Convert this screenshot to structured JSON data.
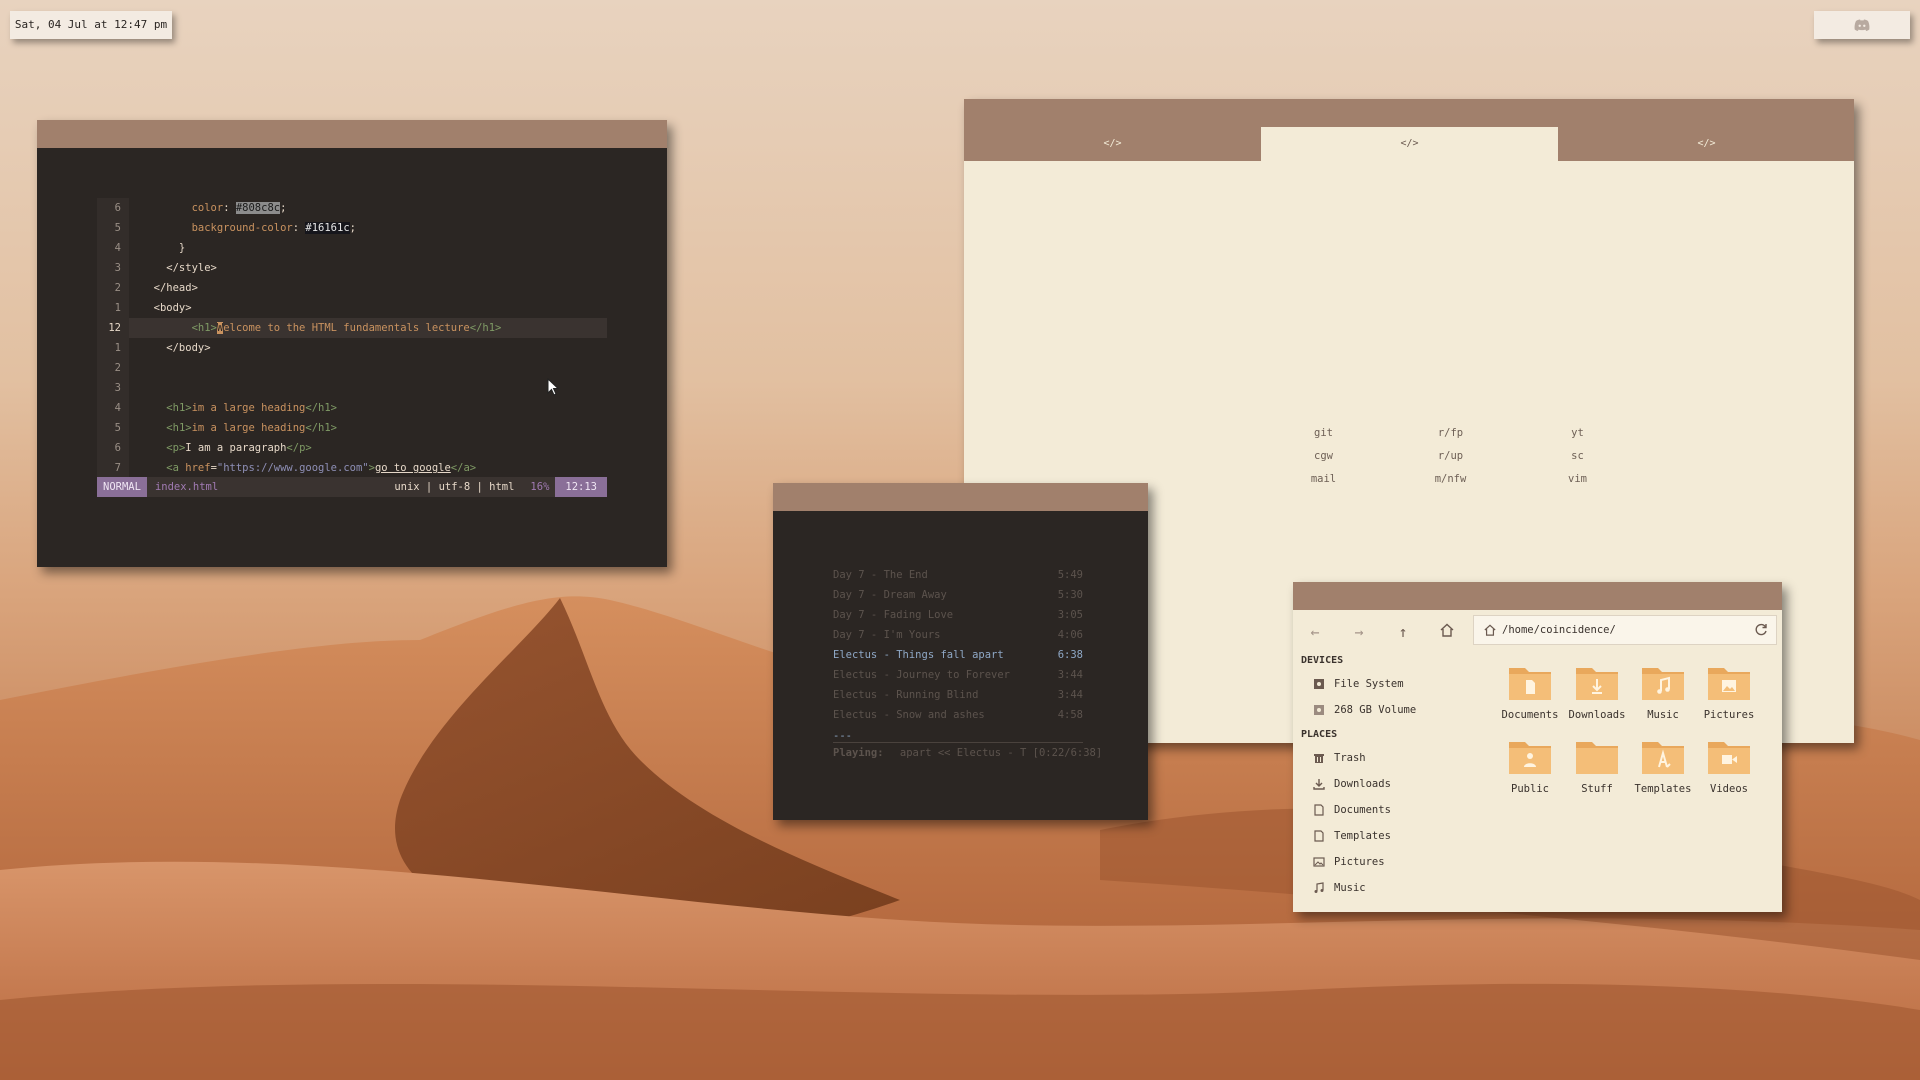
{
  "topbar": {
    "datetime": "Sat, 04 Jul at 12:47 pm",
    "tray_icon": "discord-icon"
  },
  "vim": {
    "lines": [
      {
        "num": "6",
        "code": "color: #808c8c;"
      },
      {
        "num": "5",
        "code": "background-color: #16161c;"
      },
      {
        "num": "4",
        "code": "}"
      },
      {
        "num": "3",
        "code": "</style>"
      },
      {
        "num": "2",
        "code": "</head>"
      },
      {
        "num": "1",
        "code": "<body>"
      },
      {
        "num": "12",
        "code": "<h1>Welcome to the HTML fundamentals lecture</h1>"
      },
      {
        "num": "1",
        "code": "</body>"
      },
      {
        "num": "2",
        "code": ""
      },
      {
        "num": "3",
        "code": ""
      },
      {
        "num": "4",
        "code": "<h1>im a large heading</h1>"
      },
      {
        "num": "5",
        "code": "<h1>im a large heading</h1>"
      },
      {
        "num": "6",
        "code": "<p>I am a paragraph</p>"
      },
      {
        "num": "7",
        "code": "<a href=\"https://www.google.com\">go to google</a>"
      }
    ],
    "status": {
      "mode": "NORMAL",
      "file": "index.html",
      "encoding": "unix | utf-8 | html",
      "percent": "16%",
      "position": "12:13"
    }
  },
  "startpage": {
    "tabs": [
      "</>",
      "</>",
      "</>"
    ],
    "active_tab": 1,
    "links": [
      "git",
      "r/fp",
      "yt",
      "cgw",
      "r/up",
      "sc",
      "mail",
      "m/nfw",
      "vim"
    ]
  },
  "music": {
    "tracks": [
      {
        "title": "Day 7 - The End",
        "time": "5:49"
      },
      {
        "title": "Day 7 - Dream Away",
        "time": "5:30"
      },
      {
        "title": "Day 7 - Fading Love",
        "time": "3:05"
      },
      {
        "title": "Day 7 - I'm Yours",
        "time": "4:06"
      },
      {
        "title": "Electus - Things fall apart",
        "time": "6:38"
      },
      {
        "title": "Electus - Journey to Forever",
        "time": "3:44"
      },
      {
        "title": "Electus - Running Blind",
        "time": "3:44"
      },
      {
        "title": "Electus - Snow and ashes",
        "time": "4:58"
      }
    ],
    "playing_index": 4,
    "separator": "---",
    "now_playing_label": "Playing:",
    "now_playing_value": "apart << Electus - T [0:22/6:38]"
  },
  "files": {
    "path": "/home/coincidence/",
    "devices_header": "DEVICES",
    "devices": [
      {
        "label": "File System",
        "icon": "hard-drive-icon"
      },
      {
        "label": "268 GB Volume",
        "icon": "hard-drive-icon"
      }
    ],
    "places_header": "PLACES",
    "places": [
      {
        "label": "Trash",
        "icon": "trash-icon"
      },
      {
        "label": "Downloads",
        "icon": "download-icon"
      },
      {
        "label": "Documents",
        "icon": "document-icon"
      },
      {
        "label": "Templates",
        "icon": "template-icon"
      },
      {
        "label": "Pictures",
        "icon": "picture-icon"
      },
      {
        "label": "Music",
        "icon": "music-note-icon"
      }
    ],
    "folders": [
      {
        "label": "Documents",
        "icon": "folder-documents-icon"
      },
      {
        "label": "Downloads",
        "icon": "folder-downloads-icon"
      },
      {
        "label": "Music",
        "icon": "folder-music-icon"
      },
      {
        "label": "Pictures",
        "icon": "folder-pictures-icon"
      },
      {
        "label": "Public",
        "icon": "folder-public-icon"
      },
      {
        "label": "Stuff",
        "icon": "folder-icon"
      },
      {
        "label": "Templates",
        "icon": "folder-templates-icon"
      },
      {
        "label": "Videos",
        "icon": "folder-videos-icon"
      }
    ]
  },
  "colors": {
    "titlebar": "#a1806c",
    "panel_dark": "#2b2623",
    "panel_light": "#f3ebd7",
    "folder": "#f0b669",
    "accent_purple": "#8a6f98"
  }
}
